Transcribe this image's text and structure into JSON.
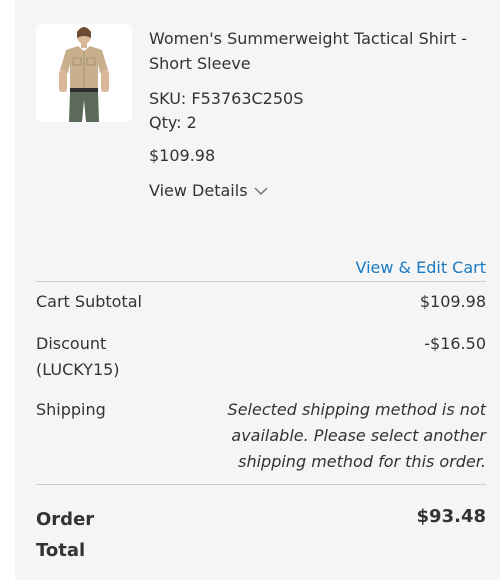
{
  "item": {
    "image_alt": "product-thumbnail",
    "name": "Women's Summerweight Tactical Shirt - Short Sleeve",
    "sku": "SKU: F53763C250S",
    "qty": "Qty: 2",
    "price": "$109.98",
    "view_details_label": "View Details",
    "view_details_icon": "chevron-down-icon"
  },
  "links": {
    "edit_cart": "View & Edit Cart",
    "link_color": "#1979c3"
  },
  "summary": {
    "subtotal_label": "Cart Subtotal",
    "subtotal_value": "$109.98",
    "discount_label": "Discount (LUCKY15)",
    "discount_value": "-$16.50",
    "shipping_label": "Shipping",
    "shipping_message": "Selected shipping method is not available. Please select another shipping method for this order.",
    "total_label": "Order Total",
    "total_value": "$93.48"
  },
  "colors": {
    "panel_bg": "#f5f5f5",
    "text": "#333333",
    "divider": "#cccccc"
  }
}
